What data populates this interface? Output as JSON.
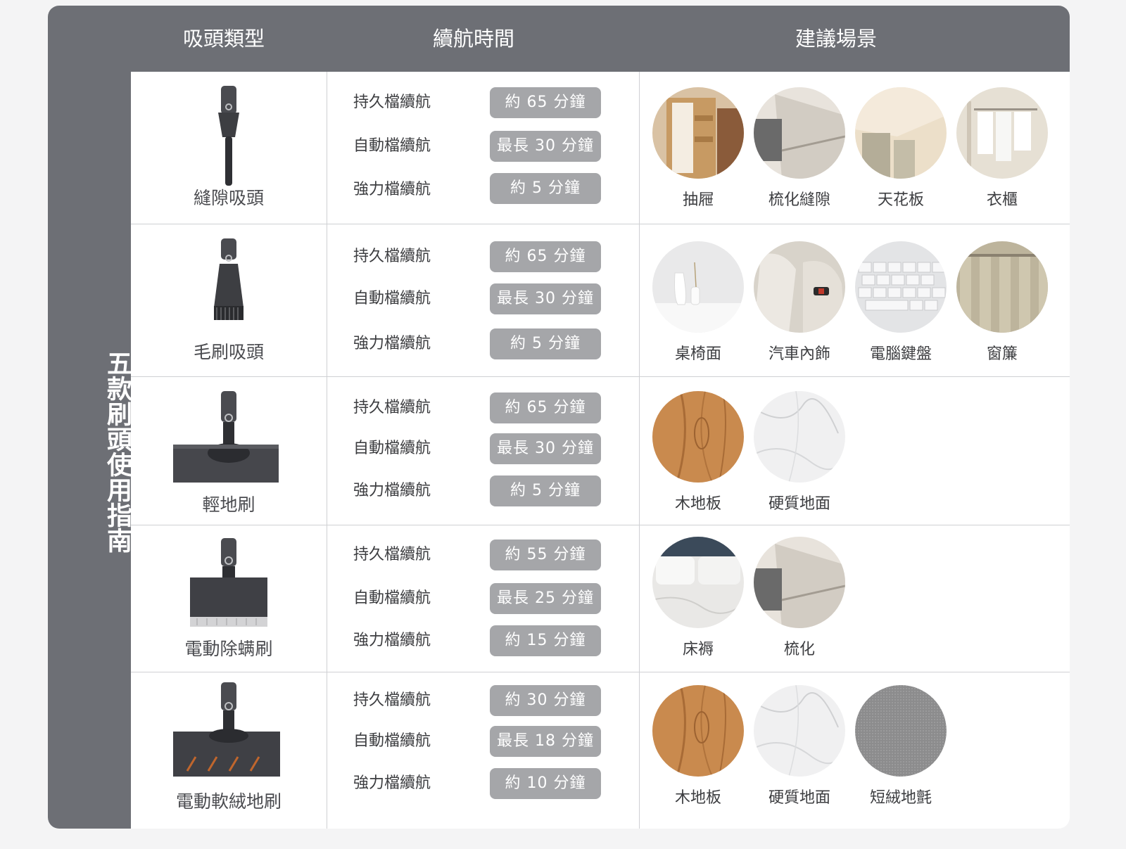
{
  "header": {
    "col1": "吸頭類型",
    "col2": "續航時間",
    "col3": "建議場景"
  },
  "sidebar": {
    "title": "五款刷頭使用指南"
  },
  "run_modes": [
    "持久檔續航",
    "自動檔續航",
    "強力檔續航"
  ],
  "rows": [
    {
      "name": "縫隙吸頭",
      "runtimes": [
        "約 65 分鐘",
        "最長 30 分鐘",
        "約 5 分鐘"
      ],
      "scenes": [
        "抽屜",
        "梳化縫隙",
        "天花板",
        "衣櫃"
      ]
    },
    {
      "name": "毛刷吸頭",
      "runtimes": [
        "約 65 分鐘",
        "最長 30 分鐘",
        "約 5 分鐘"
      ],
      "scenes": [
        "桌椅面",
        "汽車內飾",
        "電腦鍵盤",
        "窗簾"
      ]
    },
    {
      "name": "輕地刷",
      "runtimes": [
        "約 65 分鐘",
        "最長 30 分鐘",
        "約 5 分鐘"
      ],
      "scenes": [
        "木地板",
        "硬質地面"
      ]
    },
    {
      "name": "電動除螨刷",
      "runtimes": [
        "約 55 分鐘",
        "最長 25 分鐘",
        "約 15 分鐘"
      ],
      "scenes": [
        "床褥",
        "梳化"
      ]
    },
    {
      "name": "電動軟絨地刷",
      "runtimes": [
        "約 30 分鐘",
        "最長 18 分鐘",
        "約 10 分鐘"
      ],
      "scenes": [
        "木地板",
        "硬質地面",
        "短絨地氈"
      ]
    }
  ]
}
